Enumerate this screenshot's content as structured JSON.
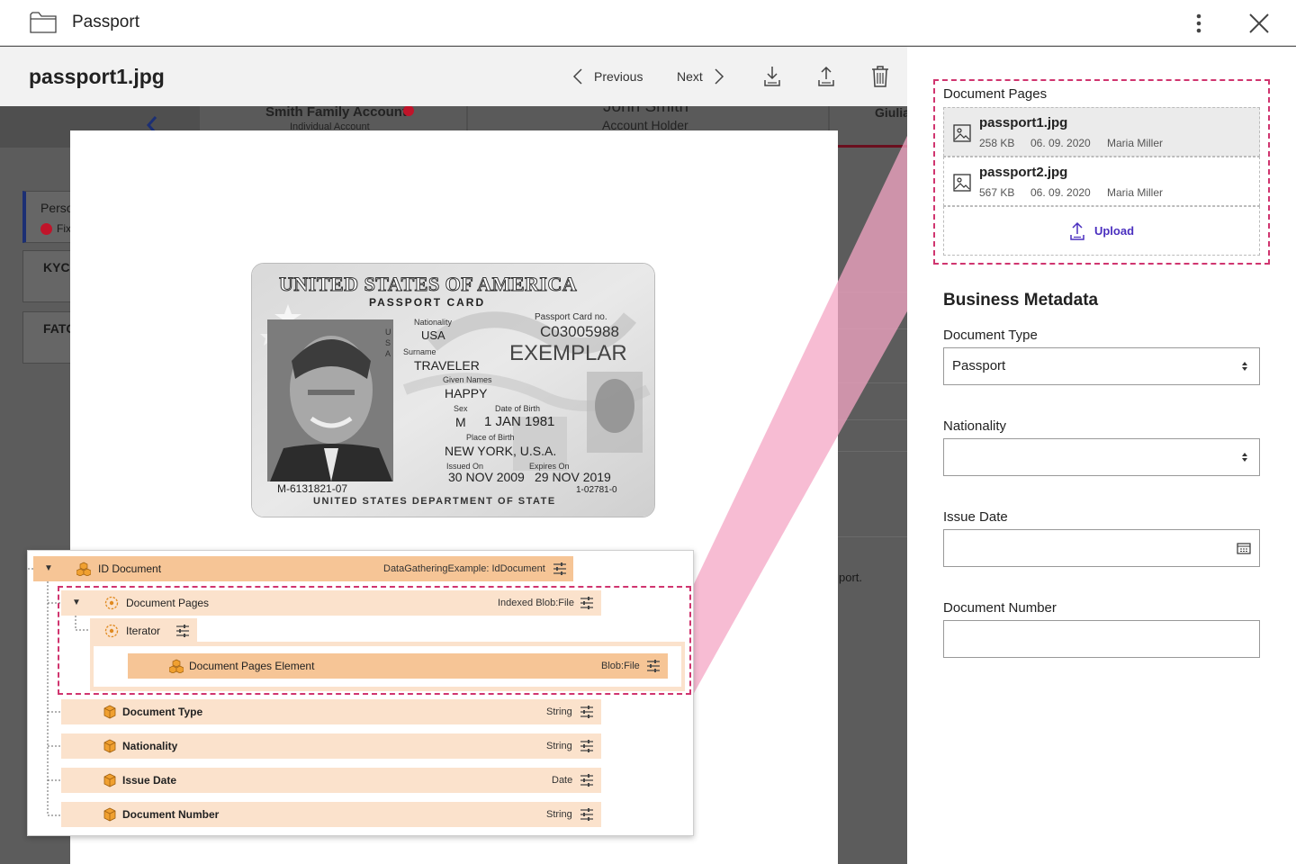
{
  "topbar": {
    "title": "Passport"
  },
  "filebar": {
    "filename": "passport1.jpg",
    "previous_label": "Previous",
    "next_label": "Next"
  },
  "background": {
    "tab1": "Smith Family Account",
    "tab1_sub": "Individual Account",
    "tab2": "John Smith",
    "tab2_sub": "Account Holder",
    "tab3": "Giulia",
    "card1": "Perso",
    "card1_sub": "Fix",
    "card2": "KYC",
    "card3": "FATC",
    "frag": "port."
  },
  "passport": {
    "title": "UNITED STATES OF AMERICA",
    "subtitle": "PASSPORT CARD",
    "nationality_label": "Nationality",
    "nationality": "USA",
    "card_no_label": "Passport Card no.",
    "card_no": "C03005988",
    "surname_label": "Surname",
    "surname": "TRAVELER",
    "exemplar": "EXEMPLAR",
    "given_label": "Given Names",
    "given": "HAPPY",
    "sex_label": "Sex",
    "sex": "M",
    "dob_label": "Date of Birth",
    "dob": "1 JAN 1981",
    "pob_label": "Place of Birth",
    "pob": "NEW YORK, U.S.A.",
    "issued_label": "Issued On",
    "issued": "30 NOV 2009",
    "expires_label": "Expires On",
    "expires": "29 NOV 2019",
    "num_left": "M-6131821-07",
    "num_right": "1-02781-0",
    "footer": "UNITED STATES DEPARTMENT OF STATE",
    "vertical": "USA"
  },
  "tree": {
    "root": {
      "label": "ID Document",
      "type": "DataGatheringExample: IdDocument"
    },
    "pages": {
      "label": "Document Pages",
      "type": "Indexed Blob:File"
    },
    "iterator": {
      "label": "Iterator"
    },
    "element": {
      "label": "Document Pages Element",
      "type": "Blob:File"
    },
    "fields": [
      {
        "label": "Document Type",
        "type": "String"
      },
      {
        "label": "Nationality",
        "type": "String"
      },
      {
        "label": "Issue Date",
        "type": "Date"
      },
      {
        "label": "Document Number",
        "type": "String"
      }
    ]
  },
  "side": {
    "doc_pages_title": "Document Pages",
    "files": [
      {
        "name": "passport1.jpg",
        "size": "258 KB",
        "date": "06. 09. 2020",
        "user": "Maria Miller"
      },
      {
        "name": "passport2.jpg",
        "size": "567 KB",
        "date": "06. 09. 2020",
        "user": "Maria Miller"
      }
    ],
    "upload_label": "Upload",
    "metadata_title": "Business Metadata",
    "doc_type_label": "Document Type",
    "doc_type_value": "Passport",
    "nationality_label": "Nationality",
    "nationality_value": "",
    "issue_date_label": "Issue Date",
    "issue_date_value": "",
    "doc_number_label": "Document Number",
    "doc_number_value": ""
  },
  "colors": {
    "highlight": "#d0356f",
    "projection": "#f4a6c4",
    "node_dark": "#f6c596",
    "node_light": "#fbe2cc",
    "accent": "#4a2fbf"
  },
  "icons": [
    "folder-icon",
    "kebab-icon",
    "close-icon",
    "chevron-left-icon",
    "chevron-right-icon",
    "download-icon",
    "upload-icon",
    "trash-icon",
    "image-file-icon",
    "cube-icon",
    "cubes-icon",
    "iterator-icon",
    "settings-sliders-icon",
    "select-arrows-icon",
    "calendar-icon"
  ]
}
